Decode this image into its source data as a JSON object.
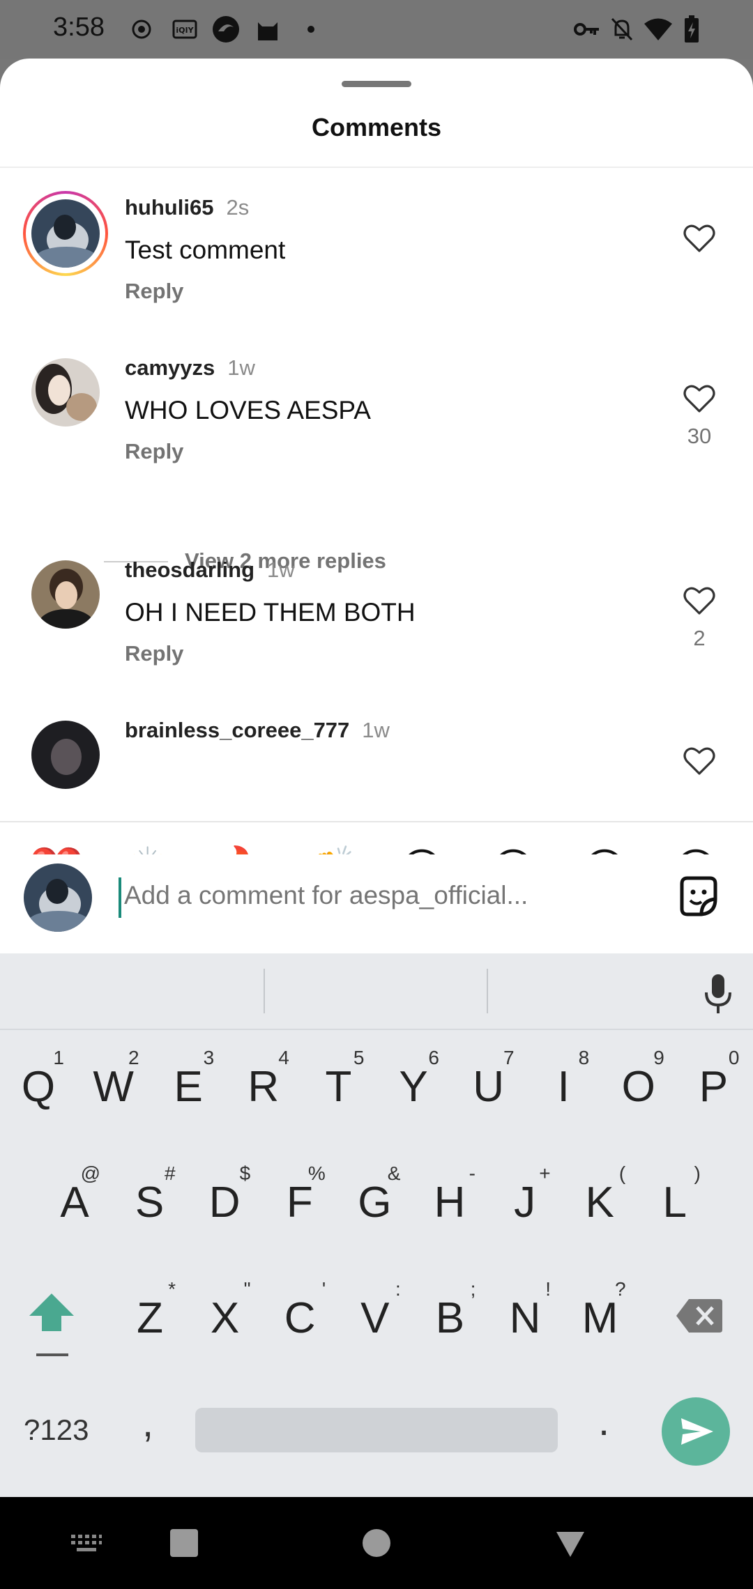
{
  "status_bar": {
    "time": "3:58",
    "icons": [
      "record-icon",
      "iqiyi-icon",
      "browser-icon",
      "cat-icon",
      "dot-icon",
      "vpn-key-icon",
      "notifications-off-icon",
      "wifi-icon",
      "battery-charging-icon"
    ]
  },
  "sheet": {
    "title": "Comments"
  },
  "comments": [
    {
      "username": "huhuli65",
      "time": "2s",
      "text": "Test comment",
      "reply": "Reply",
      "likes": ""
    },
    {
      "username": "camyyzs",
      "time": "1w",
      "text": "WHO LOVES AESPA",
      "reply": "Reply",
      "likes": "30",
      "more_replies": "View 2 more replies"
    },
    {
      "username": "theosdarling",
      "time": "1w",
      "text": "OH I NEED THEM BOTH",
      "reply": "Reply",
      "likes": "2"
    },
    {
      "username": "brainless_coreee_777",
      "time": "1w",
      "text": "",
      "reply": "",
      "likes": ""
    }
  ],
  "quick_emojis": [
    "❤️",
    "🙌",
    "🔥",
    "👏",
    "😢",
    "😍",
    "😮",
    "😂"
  ],
  "input": {
    "placeholder": "Add a comment for aespa_official..."
  },
  "keyboard": {
    "row1": [
      {
        "k": "Q",
        "h": "1"
      },
      {
        "k": "W",
        "h": "2"
      },
      {
        "k": "E",
        "h": "3"
      },
      {
        "k": "R",
        "h": "4"
      },
      {
        "k": "T",
        "h": "5"
      },
      {
        "k": "Y",
        "h": "6"
      },
      {
        "k": "U",
        "h": "7"
      },
      {
        "k": "I",
        "h": "8"
      },
      {
        "k": "O",
        "h": "9"
      },
      {
        "k": "P",
        "h": "0"
      }
    ],
    "row2": [
      {
        "k": "A",
        "h": "@"
      },
      {
        "k": "S",
        "h": "#"
      },
      {
        "k": "D",
        "h": "$"
      },
      {
        "k": "F",
        "h": "%"
      },
      {
        "k": "G",
        "h": "&"
      },
      {
        "k": "H",
        "h": "-"
      },
      {
        "k": "J",
        "h": "+"
      },
      {
        "k": "K",
        "h": "("
      },
      {
        "k": "L",
        "h": ")"
      }
    ],
    "row3": [
      {
        "k": "Z",
        "h": "*"
      },
      {
        "k": "X",
        "h": "\""
      },
      {
        "k": "C",
        "h": "'"
      },
      {
        "k": "V",
        "h": ":"
      },
      {
        "k": "B",
        "h": ";"
      },
      {
        "k": "N",
        "h": "!"
      },
      {
        "k": "M",
        "h": "?"
      }
    ],
    "symbols_label": "?123",
    "comma": ",",
    "period": "."
  },
  "colors": {
    "accent": "#5cb59b",
    "caret": "#1a8a7a",
    "secondary_text": "#737373"
  }
}
